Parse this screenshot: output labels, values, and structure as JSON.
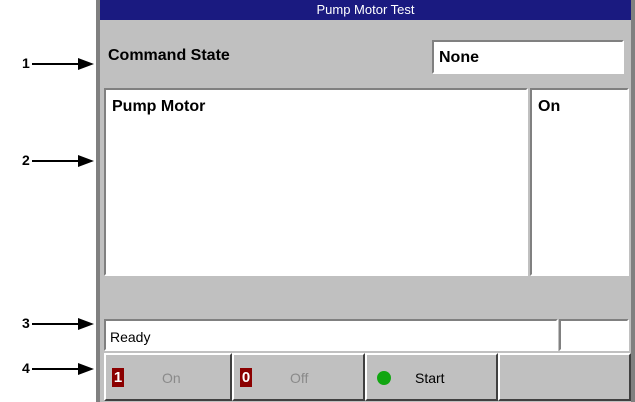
{
  "window": {
    "title": "Pump Motor Test"
  },
  "command": {
    "label": "Command State",
    "value": "None"
  },
  "component": {
    "name": "Pump Motor",
    "state": "On"
  },
  "status": {
    "text": "Ready",
    "secondary": ""
  },
  "buttons": {
    "on": {
      "glyph": "1",
      "label": "On",
      "enabled": false
    },
    "off": {
      "glyph": "0",
      "label": "Off",
      "enabled": false
    },
    "start": {
      "label": "Start",
      "enabled": true,
      "indicator_color": "#11a611"
    }
  },
  "callouts": [
    "1",
    "2",
    "3",
    "4"
  ],
  "colors": {
    "titlebar": "#1a1a80",
    "window_bg": "#c0c0c0",
    "glyph_bg": "#8b0000"
  }
}
